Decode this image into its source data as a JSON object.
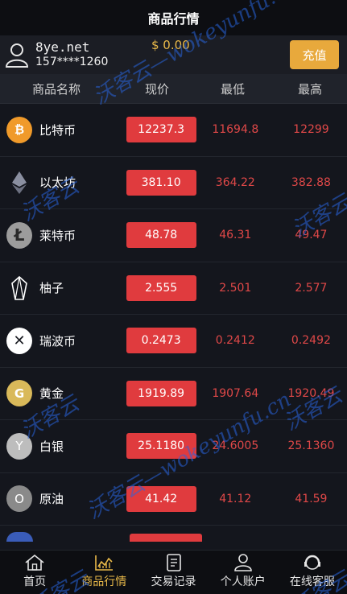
{
  "header": {
    "title": "商品行情"
  },
  "account": {
    "name": "8ye.net",
    "phone": "157****1260",
    "balance": "$ 0.00",
    "recharge_label": "充值"
  },
  "columns": {
    "name": "商品名称",
    "price": "现价",
    "low": "最低",
    "high": "最高"
  },
  "rows": [
    {
      "icon": "bitcoin-icon",
      "icon_glyph": "₿",
      "icon_color": "#f09a2a",
      "name": "比特币",
      "price": "12237.3",
      "low": "11694.8",
      "high": "12299"
    },
    {
      "icon": "ethereum-icon",
      "icon_glyph": "◆",
      "icon_color": "#1a1c22",
      "name": "以太坊",
      "price": "381.10",
      "low": "364.22",
      "high": "382.88"
    },
    {
      "icon": "litecoin-icon",
      "icon_glyph": "Ł",
      "icon_color": "#9c9c9c",
      "name": "莱特币",
      "price": "48.78",
      "low": "46.31",
      "high": "49.47"
    },
    {
      "icon": "eos-icon",
      "icon_glyph": "⬡",
      "icon_color": "#1a1c22",
      "name": "柚子",
      "price": "2.555",
      "low": "2.501",
      "high": "2.577"
    },
    {
      "icon": "ripple-icon",
      "icon_glyph": "✕",
      "icon_color": "#ffffff",
      "name": "瑞波币",
      "price": "0.2473",
      "low": "0.2412",
      "high": "0.2492"
    },
    {
      "icon": "gold-icon",
      "icon_glyph": "G",
      "icon_color": "#d9b95a",
      "name": "黄金",
      "price": "1919.89",
      "low": "1907.64",
      "high": "1920.49"
    },
    {
      "icon": "silver-icon",
      "icon_glyph": "Y",
      "icon_color": "#bdbdbd",
      "name": "白银",
      "price": "25.1180",
      "low": "24.6005",
      "high": "25.1360"
    },
    {
      "icon": "oil-icon",
      "icon_glyph": "O",
      "icon_color": "#8a8a8a",
      "name": "原油",
      "price": "41.42",
      "low": "41.12",
      "high": "41.59"
    }
  ],
  "tabs": [
    {
      "label": "首页",
      "icon": "home-icon"
    },
    {
      "label": "商品行情",
      "icon": "market-chart-icon"
    },
    {
      "label": "交易记录",
      "icon": "records-icon"
    },
    {
      "label": "个人账户",
      "icon": "user-icon"
    },
    {
      "label": "在线客服",
      "icon": "support-icon"
    }
  ],
  "watermark": {
    "text_cn": "沃客云",
    "text_en": "—wokeyunfu.cn"
  },
  "colors": {
    "accent": "#e9b949",
    "price_bg": "#e03b3e",
    "price_text_red": "#e04848",
    "button": "#e8a93c"
  }
}
